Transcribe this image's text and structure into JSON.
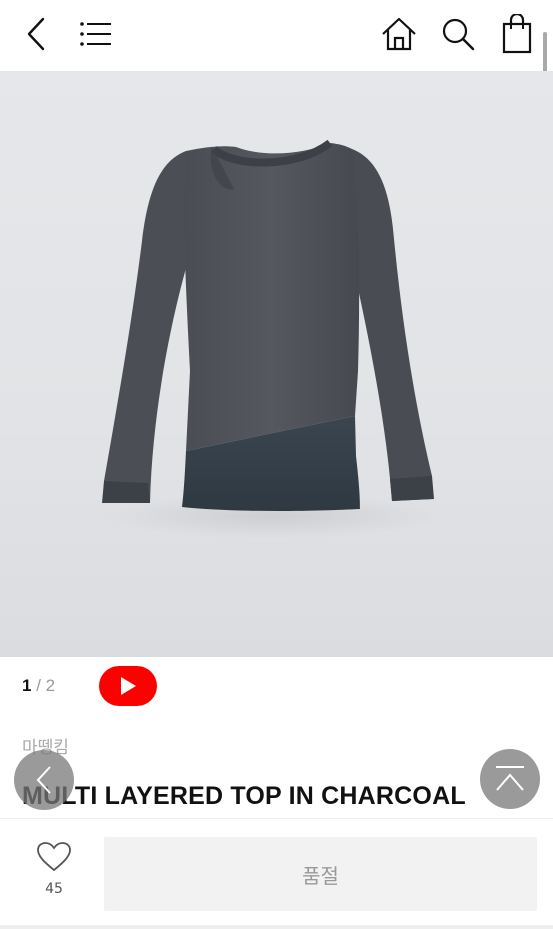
{
  "header": {
    "back_icon": "chevron-left-icon",
    "menu_icon": "hamburger-menu-icon",
    "home_icon": "home-icon",
    "search_icon": "search-icon",
    "cart_icon": "shopping-bag-icon"
  },
  "gallery": {
    "current": "1",
    "separator": "/",
    "total": "2",
    "video_icon": "youtube-play-icon"
  },
  "product": {
    "brand": "마뗑킴",
    "name": "MULTI LAYERED TOP IN CHARCOAL"
  },
  "actions": {
    "like_count": "45",
    "soldout_label": "품절"
  },
  "colors": {
    "youtube_red": "#ff0000",
    "background": "#ffffff",
    "muted_text": "#999999"
  }
}
